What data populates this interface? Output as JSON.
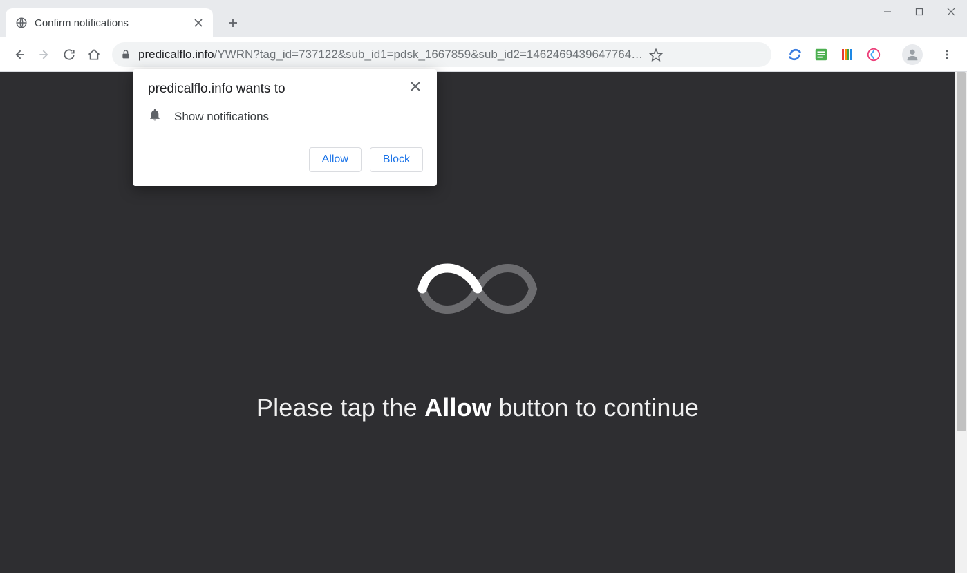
{
  "window": {
    "minimize_icon": "minimize",
    "maximize_icon": "maximize",
    "close_icon": "close"
  },
  "tab": {
    "title": "Confirm notifications"
  },
  "address": {
    "domain": "predicalflo.info",
    "path": "/YWRN?tag_id=737122&sub_id1=pdsk_1667859&sub_id2=1462469439647764…"
  },
  "permission": {
    "title": "predicalflo.info wants to",
    "option": "Show notifications",
    "allow_label": "Allow",
    "block_label": "Block"
  },
  "page": {
    "message_prefix": "Please tap the ",
    "message_bold": "Allow",
    "message_suffix": " button to continue"
  }
}
